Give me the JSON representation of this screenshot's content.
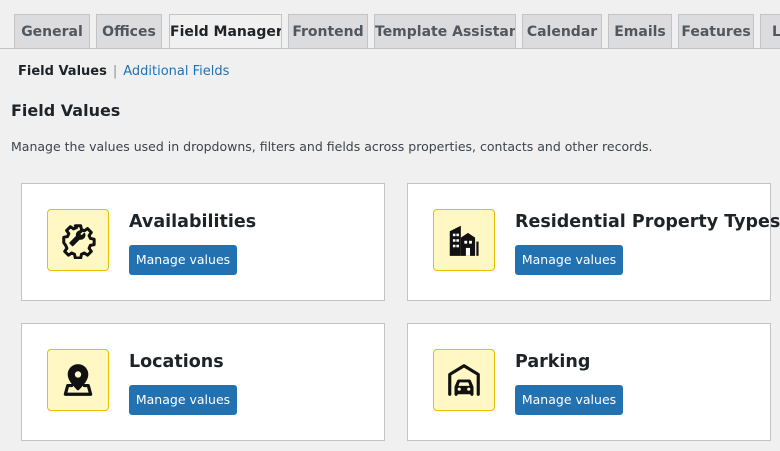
{
  "tabs": [
    {
      "label": "General",
      "active": false
    },
    {
      "label": "Offices",
      "active": false
    },
    {
      "label": "Field Manager",
      "active": true
    },
    {
      "label": "Frontend",
      "active": false
    },
    {
      "label": "Template Assistant",
      "active": false
    },
    {
      "label": "Calendar",
      "active": false
    },
    {
      "label": "Emails",
      "active": false
    },
    {
      "label": "Features",
      "active": false
    },
    {
      "label": "Li",
      "active": false
    }
  ],
  "subnav": {
    "current": "Field Values",
    "separator": "|",
    "link": "Additional Fields"
  },
  "page": {
    "title": "Field Values",
    "description": "Manage the values used in dropdowns, filters and fields across properties, contacts and other records."
  },
  "cards": [
    {
      "title": "Availabilities",
      "button": "Manage values",
      "icon": "gear-wrench-icon"
    },
    {
      "title": "Residential Property Types",
      "button": "Manage values",
      "icon": "buildings-icon"
    },
    {
      "title": "Locations",
      "button": "Manage values",
      "icon": "map-pin-icon"
    },
    {
      "title": "Parking",
      "button": "Manage values",
      "icon": "garage-car-icon"
    }
  ],
  "colors": {
    "accent": "#2271b1",
    "icon_bg": "#fff8c5",
    "icon_border": "#e5c100",
    "page_bg": "#f0f0f1"
  }
}
